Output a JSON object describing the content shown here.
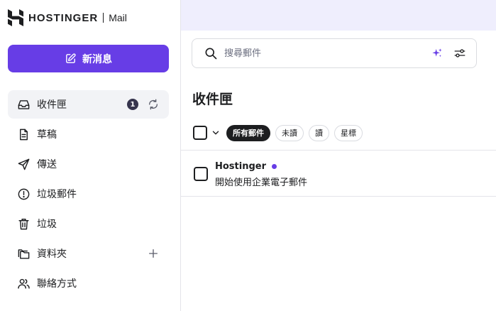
{
  "brand": {
    "name": "HOSTINGER",
    "product": "Mail"
  },
  "compose": {
    "label": "新消息"
  },
  "nav": [
    {
      "id": "inbox",
      "label": "收件匣",
      "icon": "inbox-icon",
      "badge": "1",
      "active": true,
      "trailing": "refresh-icon"
    },
    {
      "id": "drafts",
      "label": "草稿",
      "icon": "draft-icon"
    },
    {
      "id": "sent",
      "label": "傳送",
      "icon": "send-icon"
    },
    {
      "id": "spam",
      "label": "垃圾郵件",
      "icon": "spam-icon"
    },
    {
      "id": "trash",
      "label": "垃圾",
      "icon": "trash-icon"
    },
    {
      "id": "folders",
      "label": "資料夾",
      "icon": "folder-icon",
      "trailing": "plus-icon"
    },
    {
      "id": "contacts",
      "label": "聯絡方式",
      "icon": "contacts-icon"
    }
  ],
  "search": {
    "placeholder": "搜尋郵件",
    "value": ""
  },
  "folder": {
    "title": "收件匣"
  },
  "filters": [
    {
      "label": "所有郵件",
      "active": true
    },
    {
      "label": "未讀",
      "active": false
    },
    {
      "label": "讀",
      "active": false
    },
    {
      "label": "星標",
      "active": false
    }
  ],
  "messages": [
    {
      "sender": "Hostinger",
      "subject": "開始使用企業電子郵件",
      "unread": true
    }
  ],
  "colors": {
    "accent": "#673de6",
    "topbar": "#efeefd",
    "text": "#1d1e20"
  }
}
